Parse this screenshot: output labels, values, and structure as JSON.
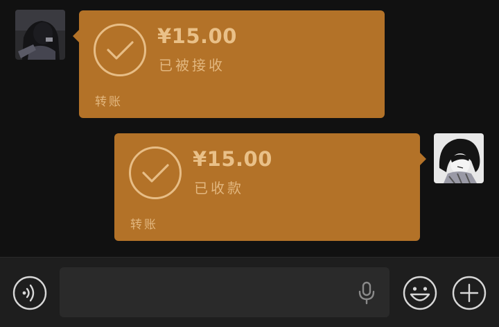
{
  "messages": [
    {
      "side": "left",
      "amount": "¥15.00",
      "status": "已被接收",
      "label": "转账"
    },
    {
      "side": "right",
      "amount": "¥15.00",
      "status": "已收款",
      "label": "转账"
    }
  ],
  "input_bar": {
    "icons": [
      "voice-icon",
      "microphone-icon",
      "emoji-icon",
      "plus-icon"
    ]
  },
  "colors": {
    "bubble": "#b37228",
    "bubble_text": "#e7bd86",
    "background": "#111111",
    "input_bar": "#1e1e1e"
  }
}
